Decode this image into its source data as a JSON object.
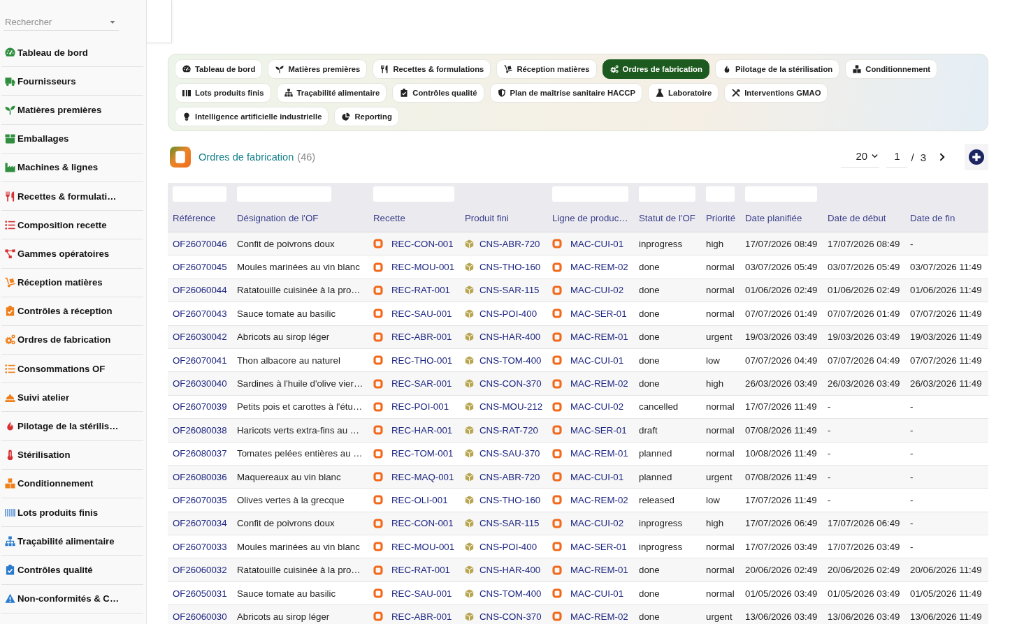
{
  "sidebar": {
    "search": {
      "placeholder": "Rechercher"
    },
    "items": [
      {
        "label": "Tableau de bord",
        "color": "#2f8f3f"
      },
      {
        "label": "Fournisseurs",
        "color": "#2f8f3f"
      },
      {
        "label": "Matières premières",
        "color": "#2f8f3f"
      },
      {
        "label": "Emballages",
        "color": "#2f8f3f"
      },
      {
        "label": "Machines & lignes",
        "color": "#2f8f3f"
      },
      {
        "label": "Recettes & formulati…",
        "color": "#d63031"
      },
      {
        "label": "Composition recette",
        "color": "#d63031"
      },
      {
        "label": "Gammes opératoires",
        "color": "#d63031"
      },
      {
        "label": "Réception matières",
        "color": "#f07f1a"
      },
      {
        "label": "Contrôles à réception",
        "color": "#f07f1a"
      },
      {
        "label": "Ordres de fabrication",
        "color": "#f07f1a"
      },
      {
        "label": "Consommations OF",
        "color": "#f07f1a"
      },
      {
        "label": "Suivi atelier",
        "color": "#f07f1a"
      },
      {
        "label": "Pilotage de la stérilis…",
        "color": "#d63031"
      },
      {
        "label": "Stérilisation",
        "color": "#d63031"
      },
      {
        "label": "Conditionnement",
        "color": "#f07f1a"
      },
      {
        "label": "Lots produits finis",
        "color": "#79a6dd"
      },
      {
        "label": "Traçabilité alimentaire",
        "color": "#2a7bcc"
      },
      {
        "label": "Contrôles qualité",
        "color": "#2a7bcc"
      },
      {
        "label": "Non-conformités & C…",
        "color": "#2a7bcc"
      }
    ]
  },
  "nav": {
    "tabs": [
      {
        "label": "Tableau de bord",
        "selected": false
      },
      {
        "label": "Matières premières",
        "selected": false
      },
      {
        "label": "Recettes & formulations",
        "selected": false
      },
      {
        "label": "Réception matières",
        "selected": false
      },
      {
        "label": "Ordres de fabrication",
        "selected": true
      },
      {
        "label": "Pilotage de la stérilisation",
        "selected": false
      },
      {
        "label": "Conditionnement",
        "selected": false
      },
      {
        "label": "Lots produits finis",
        "selected": false
      },
      {
        "label": "Traçabilité alimentaire",
        "selected": false
      },
      {
        "label": "Contrôles qualité",
        "selected": false
      },
      {
        "label": "Plan de maîtrise sanitaire HACCP",
        "selected": false
      },
      {
        "label": "Laboratoire",
        "selected": false
      },
      {
        "label": "Interventions GMAO",
        "selected": false
      },
      {
        "label": "Intelligence artificielle industrielle",
        "selected": false
      },
      {
        "label": "Reporting",
        "selected": false
      }
    ]
  },
  "list_header": {
    "title": "Ordres de fabrication",
    "count": "(46)",
    "page_size": "20",
    "page": "1",
    "page_separator": "/",
    "page_count": "3"
  },
  "table": {
    "columns": [
      {
        "label": "Référence",
        "kind": "link",
        "filter": true
      },
      {
        "label": "Désignation de l'OF",
        "kind": "text",
        "filter": true
      },
      {
        "label": "Recette",
        "kind": "record",
        "filter": true
      },
      {
        "label": "Produit fini",
        "kind": "product",
        "filter": false
      },
      {
        "label": "Ligne de produc…",
        "kind": "record",
        "filter": true
      },
      {
        "label": "Statut de l'OF",
        "kind": "text",
        "filter": true
      },
      {
        "label": "Priorité",
        "kind": "text",
        "filter": true
      },
      {
        "label": "Date planifiée",
        "kind": "text",
        "filter": true
      },
      {
        "label": "Date de début",
        "kind": "text",
        "filter": false
      },
      {
        "label": "Date de fin",
        "kind": "text",
        "filter": false
      }
    ],
    "rows": [
      [
        "OF26070046",
        "Confit de poivrons doux",
        "REC-CON-001",
        "CNS-ABR-720",
        "MAC-CUI-01",
        "inprogress",
        "high",
        "17/07/2026 08:49",
        "17/07/2026 08:49",
        "-"
      ],
      [
        "OF26070045",
        "Moules marinées au vin blanc",
        "REC-MOU-001",
        "CNS-THO-160",
        "MAC-REM-02",
        "done",
        "normal",
        "03/07/2026 05:49",
        "03/07/2026 05:49",
        "03/07/2026 11:49"
      ],
      [
        "OF26060044",
        "Ratatouille cuisinée à la pro…",
        "REC-RAT-001",
        "CNS-SAR-115",
        "MAC-CUI-02",
        "done",
        "normal",
        "01/06/2026 02:49",
        "01/06/2026 02:49",
        "01/06/2026 11:49"
      ],
      [
        "OF26070043",
        "Sauce tomate au basilic",
        "REC-SAU-001",
        "CNS-POI-400",
        "MAC-SER-01",
        "done",
        "normal",
        "07/07/2026 01:49",
        "07/07/2026 01:49",
        "07/07/2026 11:49"
      ],
      [
        "OF26030042",
        "Abricots au sirop léger",
        "REC-ABR-001",
        "CNS-HAR-400",
        "MAC-REM-01",
        "done",
        "urgent",
        "19/03/2026 03:49",
        "19/03/2026 03:49",
        "19/03/2026 11:49"
      ],
      [
        "OF26070041",
        "Thon albacore au naturel",
        "REC-THO-001",
        "CNS-TOM-400",
        "MAC-CUI-01",
        "done",
        "low",
        "07/07/2026 04:49",
        "07/07/2026 04:49",
        "07/07/2026 11:49"
      ],
      [
        "OF26030040",
        "Sardines à l'huile d'olive vier…",
        "REC-SAR-001",
        "CNS-CON-370",
        "MAC-REM-02",
        "done",
        "high",
        "26/03/2026 03:49",
        "26/03/2026 03:49",
        "26/03/2026 11:49"
      ],
      [
        "OF26070039",
        "Petits pois et carottes à l'étu…",
        "REC-POI-001",
        "CNS-MOU-212",
        "MAC-CUI-02",
        "cancelled",
        "normal",
        "17/07/2026 11:49",
        "-",
        "-"
      ],
      [
        "OF26080038",
        "Haricots verts extra-fins au …",
        "REC-HAR-001",
        "CNS-RAT-720",
        "MAC-SER-01",
        "draft",
        "normal",
        "07/08/2026 11:49",
        "-",
        "-"
      ],
      [
        "OF26080037",
        "Tomates pelées entières au …",
        "REC-TOM-001",
        "CNS-SAU-370",
        "MAC-REM-01",
        "planned",
        "normal",
        "10/08/2026 11:49",
        "-",
        "-"
      ],
      [
        "OF26080036",
        "Maquereaux au vin blanc",
        "REC-MAQ-001",
        "CNS-ABR-720",
        "MAC-CUI-01",
        "planned",
        "urgent",
        "07/08/2026 11:49",
        "-",
        "-"
      ],
      [
        "OF26070035",
        "Olives vertes à la grecque",
        "REC-OLI-001",
        "CNS-THO-160",
        "MAC-REM-02",
        "released",
        "low",
        "17/07/2026 11:49",
        "-",
        "-"
      ],
      [
        "OF26070034",
        "Confit de poivrons doux",
        "REC-CON-001",
        "CNS-SAR-115",
        "MAC-CUI-02",
        "inprogress",
        "high",
        "17/07/2026 06:49",
        "17/07/2026 06:49",
        "-"
      ],
      [
        "OF26070033",
        "Moules marinées au vin blanc",
        "REC-MOU-001",
        "CNS-POI-400",
        "MAC-SER-01",
        "inprogress",
        "normal",
        "17/07/2026 03:49",
        "17/07/2026 03:49",
        "-"
      ],
      [
        "OF26060032",
        "Ratatouille cuisinée à la pro…",
        "REC-RAT-001",
        "CNS-HAR-400",
        "MAC-REM-01",
        "done",
        "normal",
        "20/06/2026 02:49",
        "20/06/2026 02:49",
        "20/06/2026 11:49"
      ],
      [
        "OF26050031",
        "Sauce tomate au basilic",
        "REC-SAU-001",
        "CNS-TOM-400",
        "MAC-CUI-01",
        "done",
        "normal",
        "01/05/2026 03:49",
        "01/05/2026 03:49",
        "01/05/2026 11:49"
      ],
      [
        "OF26060030",
        "Abricots au sirop léger",
        "REC-ABR-001",
        "CNS-CON-370",
        "MAC-REM-02",
        "done",
        "urgent",
        "13/06/2026 03:49",
        "13/06/2026 03:49",
        "13/06/2026 11:49"
      ]
    ]
  }
}
